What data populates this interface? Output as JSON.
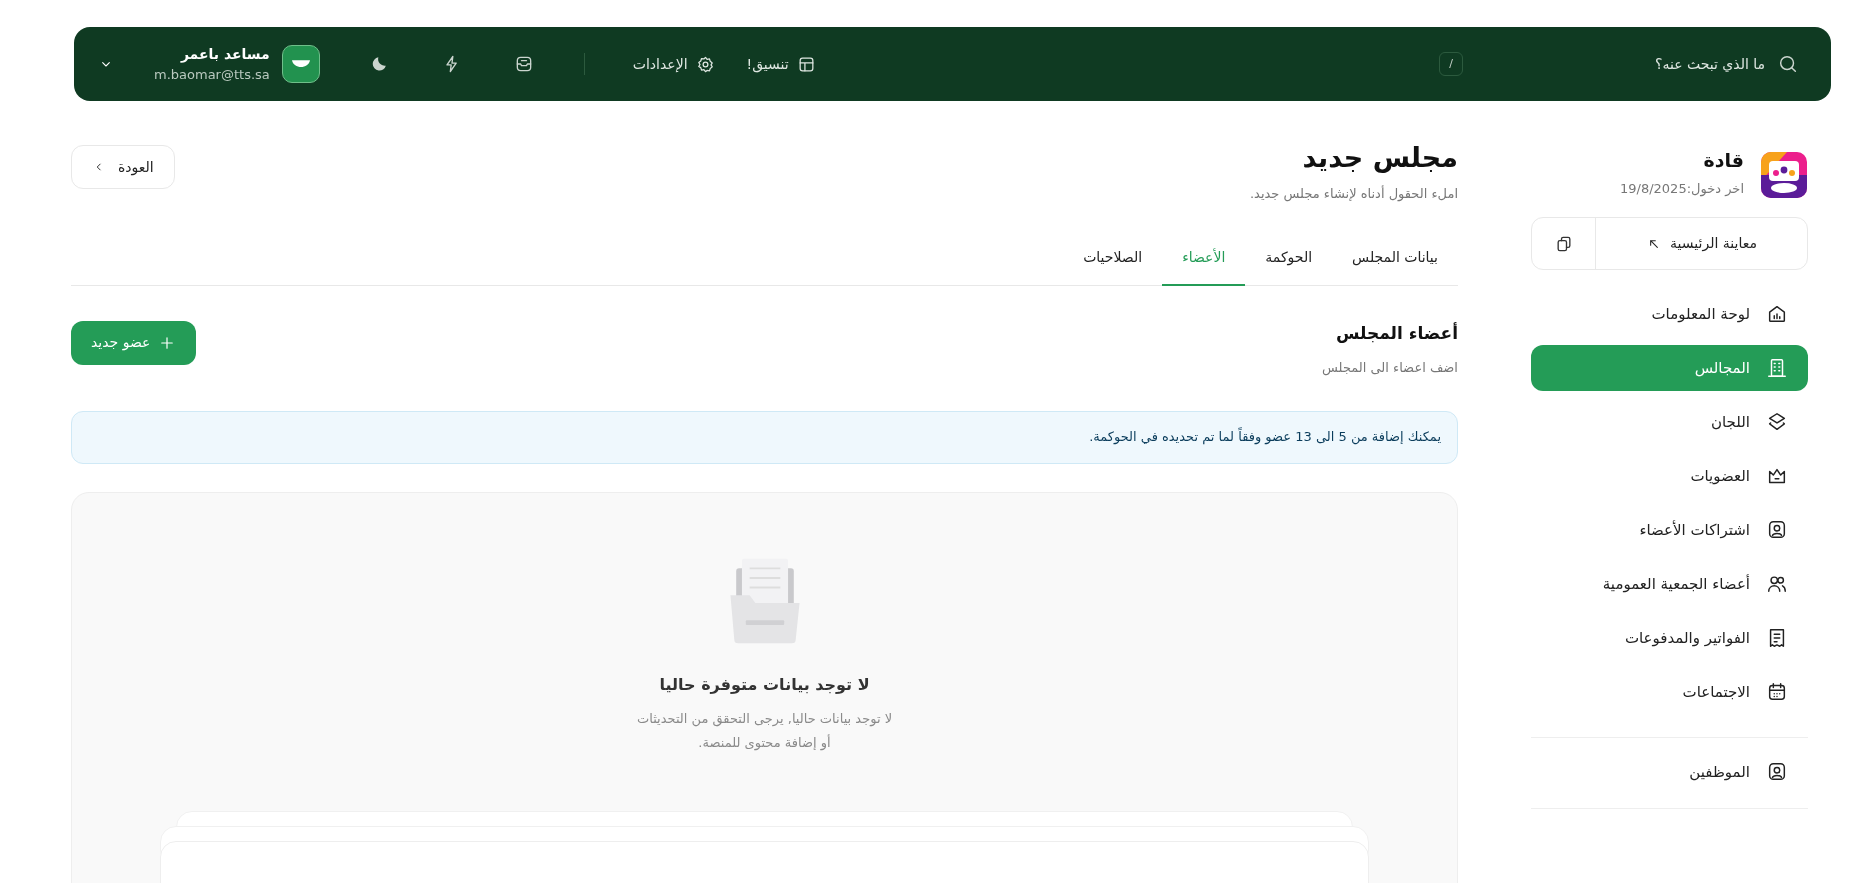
{
  "top_bar": {
    "search": {
      "placeholder": "ما الذي تبحث عنه؟",
      "shortcut": "/"
    },
    "links": [
      {
        "kind": "layout",
        "label": "تنسيق!"
      },
      {
        "kind": "settings",
        "label": "الإعدادات"
      }
    ],
    "icons": [
      {
        "kind": "inbox"
      },
      {
        "kind": "bolt"
      },
      {
        "kind": "moon"
      }
    ],
    "user": {
      "name": "مساعد باعمر",
      "email": "m.baomar@tts.sa"
    }
  },
  "sidebar": {
    "org_name": "قادة",
    "last_login": "اخر دخول:19/8/2025",
    "preview_button": "معاينة الرئيسية",
    "items": [
      {
        "kind": "dashboard",
        "label": "لوحة المعلومات",
        "selected": false
      },
      {
        "kind": "building",
        "label": "المجالس",
        "selected": true
      },
      {
        "kind": "layers",
        "label": "اللجان",
        "selected": false
      },
      {
        "kind": "crown",
        "label": "العضويات",
        "selected": false
      },
      {
        "kind": "badge",
        "label": "اشتراكات الأعضاء",
        "selected": false
      },
      {
        "kind": "users",
        "label": "أعضاء الجمعية العمومية",
        "selected": false
      },
      {
        "kind": "receipt",
        "label": "الفواتير والمدفوعات",
        "selected": false
      },
      {
        "kind": "calendar",
        "label": "الاجتماعات",
        "selected": false
      }
    ],
    "bottom_items": [
      {
        "kind": "badge",
        "label": "الموظفين",
        "selected": false
      }
    ]
  },
  "page": {
    "title": "مجلس جديد",
    "subtitle": "املء الحقول أدناه لإنشاء مجلس جديد.",
    "back_button": "العودة",
    "tabs": [
      {
        "label": "بيانات المجلس",
        "selected": false
      },
      {
        "label": "الحوكمة",
        "selected": false
      },
      {
        "label": "الأعضاء",
        "selected": true
      },
      {
        "label": "الصلاحيات",
        "selected": false
      }
    ],
    "section": {
      "title": "أعضاء المجلس",
      "subtitle": "اضف اعضاء الى المجلس",
      "add_button": "عضو جديد"
    },
    "notice": "يمكنك إضافة من 5 الى 13 عضو وفقاً لما تم تحديده في الحوكمة.",
    "empty_state": {
      "title": "لا توجد بيانات متوفرة حاليا",
      "lines": [
        "لا توجد بيانات حاليا, يرجى التحقق من التحديثات",
        "أو إضافة محتوى للمنصة."
      ]
    }
  }
}
